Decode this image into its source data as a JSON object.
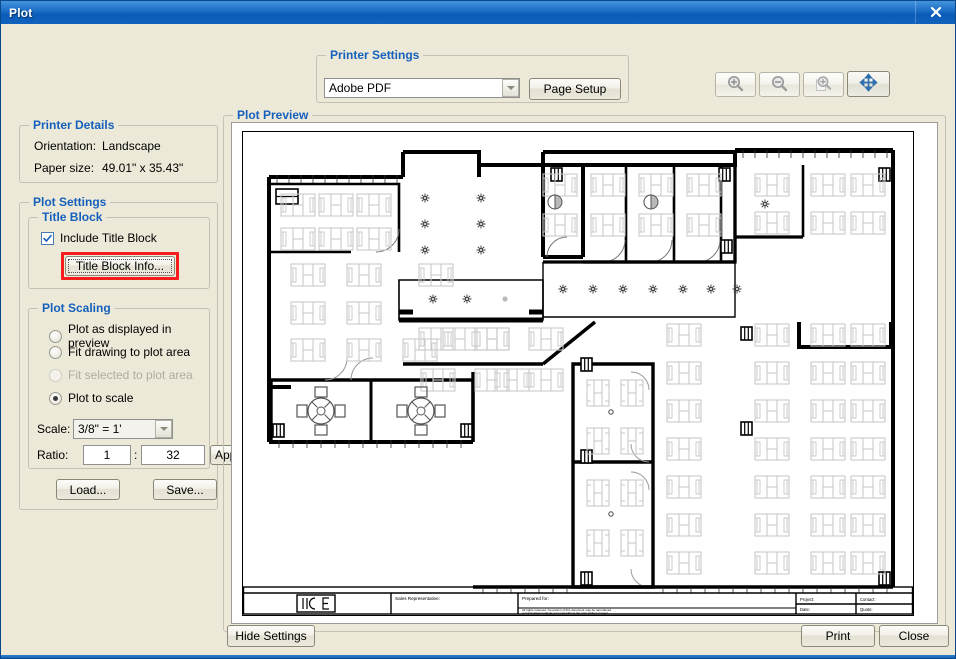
{
  "window": {
    "title": "Plot",
    "close_glyph": "✕"
  },
  "printer_settings": {
    "group_label": "Printer Settings",
    "printer_value": "Adobe PDF",
    "page_setup_label": "Page Setup"
  },
  "toolbar": {
    "zoom_in": "zoom-in-icon",
    "zoom_out": "zoom-out-icon",
    "zoom_window": "zoom-window-icon",
    "pan": "pan-move-icon"
  },
  "printer_details": {
    "group_label": "Printer Details",
    "orientation_label": "Orientation:",
    "orientation_value": "Landscape",
    "paper_size_label": "Paper size:",
    "paper_size_value": "49.01\" x 35.43\""
  },
  "plot_settings": {
    "group_label": "Plot Settings",
    "title_block": {
      "group_label": "Title Block",
      "include_label": "Include Title Block",
      "include_checked": true,
      "info_button_label": "Title Block Info...",
      "info_button_highlighted": true
    },
    "plot_scaling": {
      "group_label": "Plot Scaling",
      "options": [
        {
          "label": "Plot as displayed in preview",
          "selected": false,
          "disabled": false
        },
        {
          "label": "Fit drawing to plot area",
          "selected": false,
          "disabled": false
        },
        {
          "label": "Fit selected to plot area",
          "selected": false,
          "disabled": true
        },
        {
          "label": "Plot to scale",
          "selected": true,
          "disabled": false
        }
      ],
      "scale_label": "Scale:",
      "scale_value": "3/8\" = 1'",
      "ratio_label": "Ratio:",
      "ratio_numerator": "1",
      "ratio_separator": ":",
      "ratio_denominator": "32",
      "apply_label": "Apply"
    },
    "load_label": "Load...",
    "save_label": "Save..."
  },
  "plot_preview": {
    "group_label": "Plot Preview",
    "title_block": {
      "logo_text": "ICE",
      "sales_rep_label": "Sales Representative:",
      "prepared_for_label": "Prepared for:",
      "rights_line1": "All rights reserved.  No portion of this document may be reproduced",
      "rights_line2": "or transmitted in whole or in part without the prior written consent",
      "project_label": "Project:",
      "contact_label": "Contact:",
      "date_label": "Date:",
      "quote_label": "Quote:"
    }
  },
  "footer": {
    "hide_settings_label": "Hide Settings",
    "print_label": "Print",
    "close_label": "Close"
  },
  "colors": {
    "title_bar_blue": "#1f72c8",
    "group_label_blue": "#1560bd",
    "dialog_face": "#ece9d8",
    "annotation_red": "#f41c1c",
    "accent_pan_icon": "#2f6fae"
  }
}
